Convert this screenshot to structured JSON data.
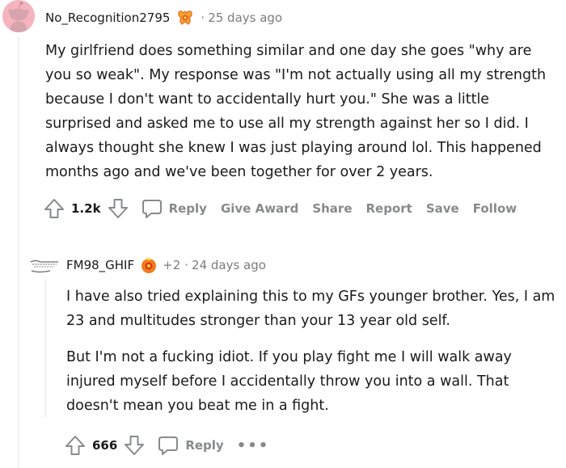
{
  "comment1": {
    "author": "No_Recognition2795",
    "separator": "·",
    "time": "25 days ago",
    "body": [
      "My girlfriend does something similar and one day she goes \"why are you so weak\". My response was \"I'm not actually using all my strength because I don't want to accidentally hurt you.\" She was a little surprised and asked me to use all my strength against her so I did. I always thought she knew I was just playing around lol. This happened months ago and we've been together for over 2 years."
    ],
    "score": "1.2k",
    "actions": {
      "reply": "Reply",
      "give_award": "Give Award",
      "share": "Share",
      "report": "Report",
      "save": "Save",
      "follow": "Follow"
    }
  },
  "comment2": {
    "author": "FM98_GHIF",
    "award_count": "+2",
    "separator": "·",
    "time": "24 days ago",
    "body": [
      "I have also tried explaining this to my GFs younger brother. Yes, I am 23 and multitudes stronger than your 13 year old self.",
      "But I'm not a fucking idiot. If you play fight me I will walk away injured myself before I accidentally throw you into a wall. That doesn't mean you beat me in a fight."
    ],
    "score": "666",
    "actions": {
      "reply": "Reply",
      "more": "•••"
    }
  },
  "icons": {
    "upvote": "upvote-arrow-icon",
    "downvote": "downvote-arrow-icon",
    "reply": "speech-bubble-icon",
    "award": "award-icon"
  },
  "colors": {
    "text": "#1a1a1b",
    "muted": "#7c7c7c",
    "action": "#878a8c",
    "avatar_bg": "#f6b4bf"
  }
}
